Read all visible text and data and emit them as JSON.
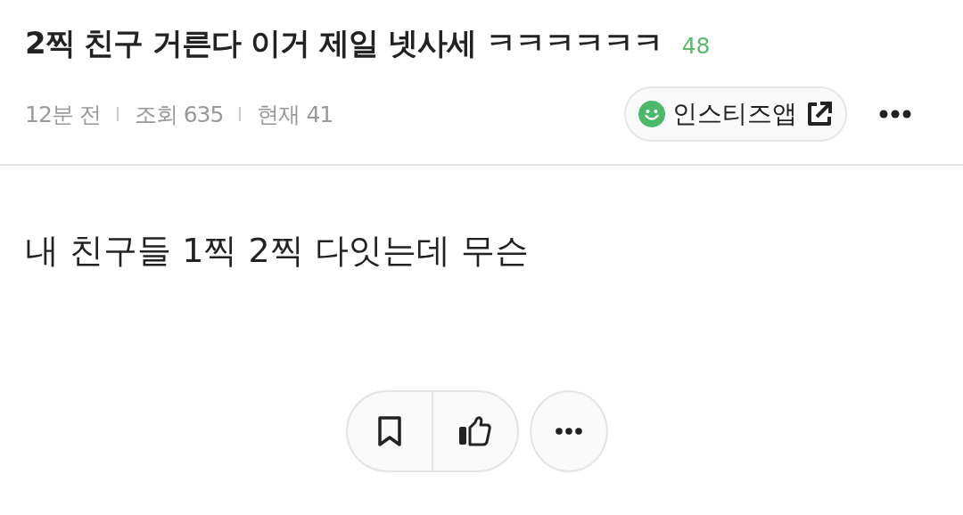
{
  "post": {
    "title": "2찍 친구 거른다 이거 제일 넷사세 ㅋㅋㅋㅋㅋㅋ",
    "comment_count": "48",
    "meta": [
      "12분 전",
      "조회 635",
      "현재 41"
    ],
    "app_link": {
      "label": "인스티즈앱"
    },
    "body": "내 친구들 1찍 2찍 다잇는데 무슨"
  }
}
